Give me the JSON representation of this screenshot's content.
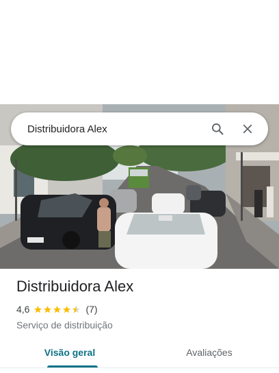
{
  "search": {
    "value": "Distribuidora Alex",
    "search_icon": "search-icon",
    "close_icon": "close-icon"
  },
  "place": {
    "name": "Distribuidora Alex",
    "rating": "4,6",
    "stars_shown": 4.5,
    "review_count": "(7)",
    "category": "Serviço de distribuição"
  },
  "tabs": [
    {
      "label": "Visão geral",
      "active": true
    },
    {
      "label": "Avaliações",
      "active": false
    }
  ],
  "colors": {
    "accent": "#0b7285",
    "star": "#fbbc04",
    "text_primary": "#202124",
    "text_secondary": "#70757a"
  }
}
